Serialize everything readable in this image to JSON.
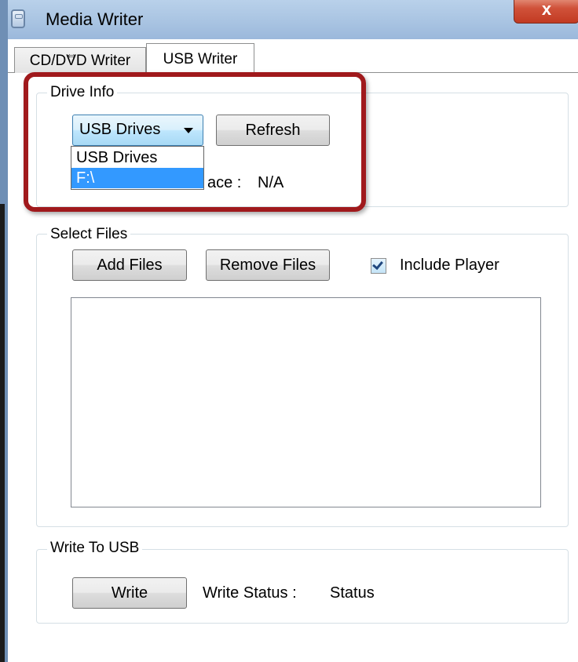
{
  "window": {
    "title": "Media Writer",
    "close_glyph": "x"
  },
  "tabs": [
    {
      "label": "CD/DVD Writer",
      "active": false
    },
    {
      "label": "USB Writer",
      "active": true
    }
  ],
  "drive_info": {
    "group_label": "Drive Info",
    "combo_value": "USB Drives",
    "dropdown_options": [
      "USB Drives",
      "F:\\"
    ],
    "selected_option": "F:\\",
    "refresh_label": "Refresh",
    "free_space_label_visible": "ace :",
    "free_space_value": "N/A"
  },
  "select_files": {
    "group_label": "Select Files",
    "add_label": "Add Files",
    "remove_label": "Remove Files",
    "include_player_label": "Include Player",
    "include_player_checked": true
  },
  "write_to_usb": {
    "group_label": "Write To USB",
    "write_label": "Write",
    "status_label": "Write Status :",
    "status_value": "Status"
  },
  "colors": {
    "highlight_border": "#a0191c",
    "selection": "#3399ff",
    "titlebar": "#a9c4e2"
  }
}
